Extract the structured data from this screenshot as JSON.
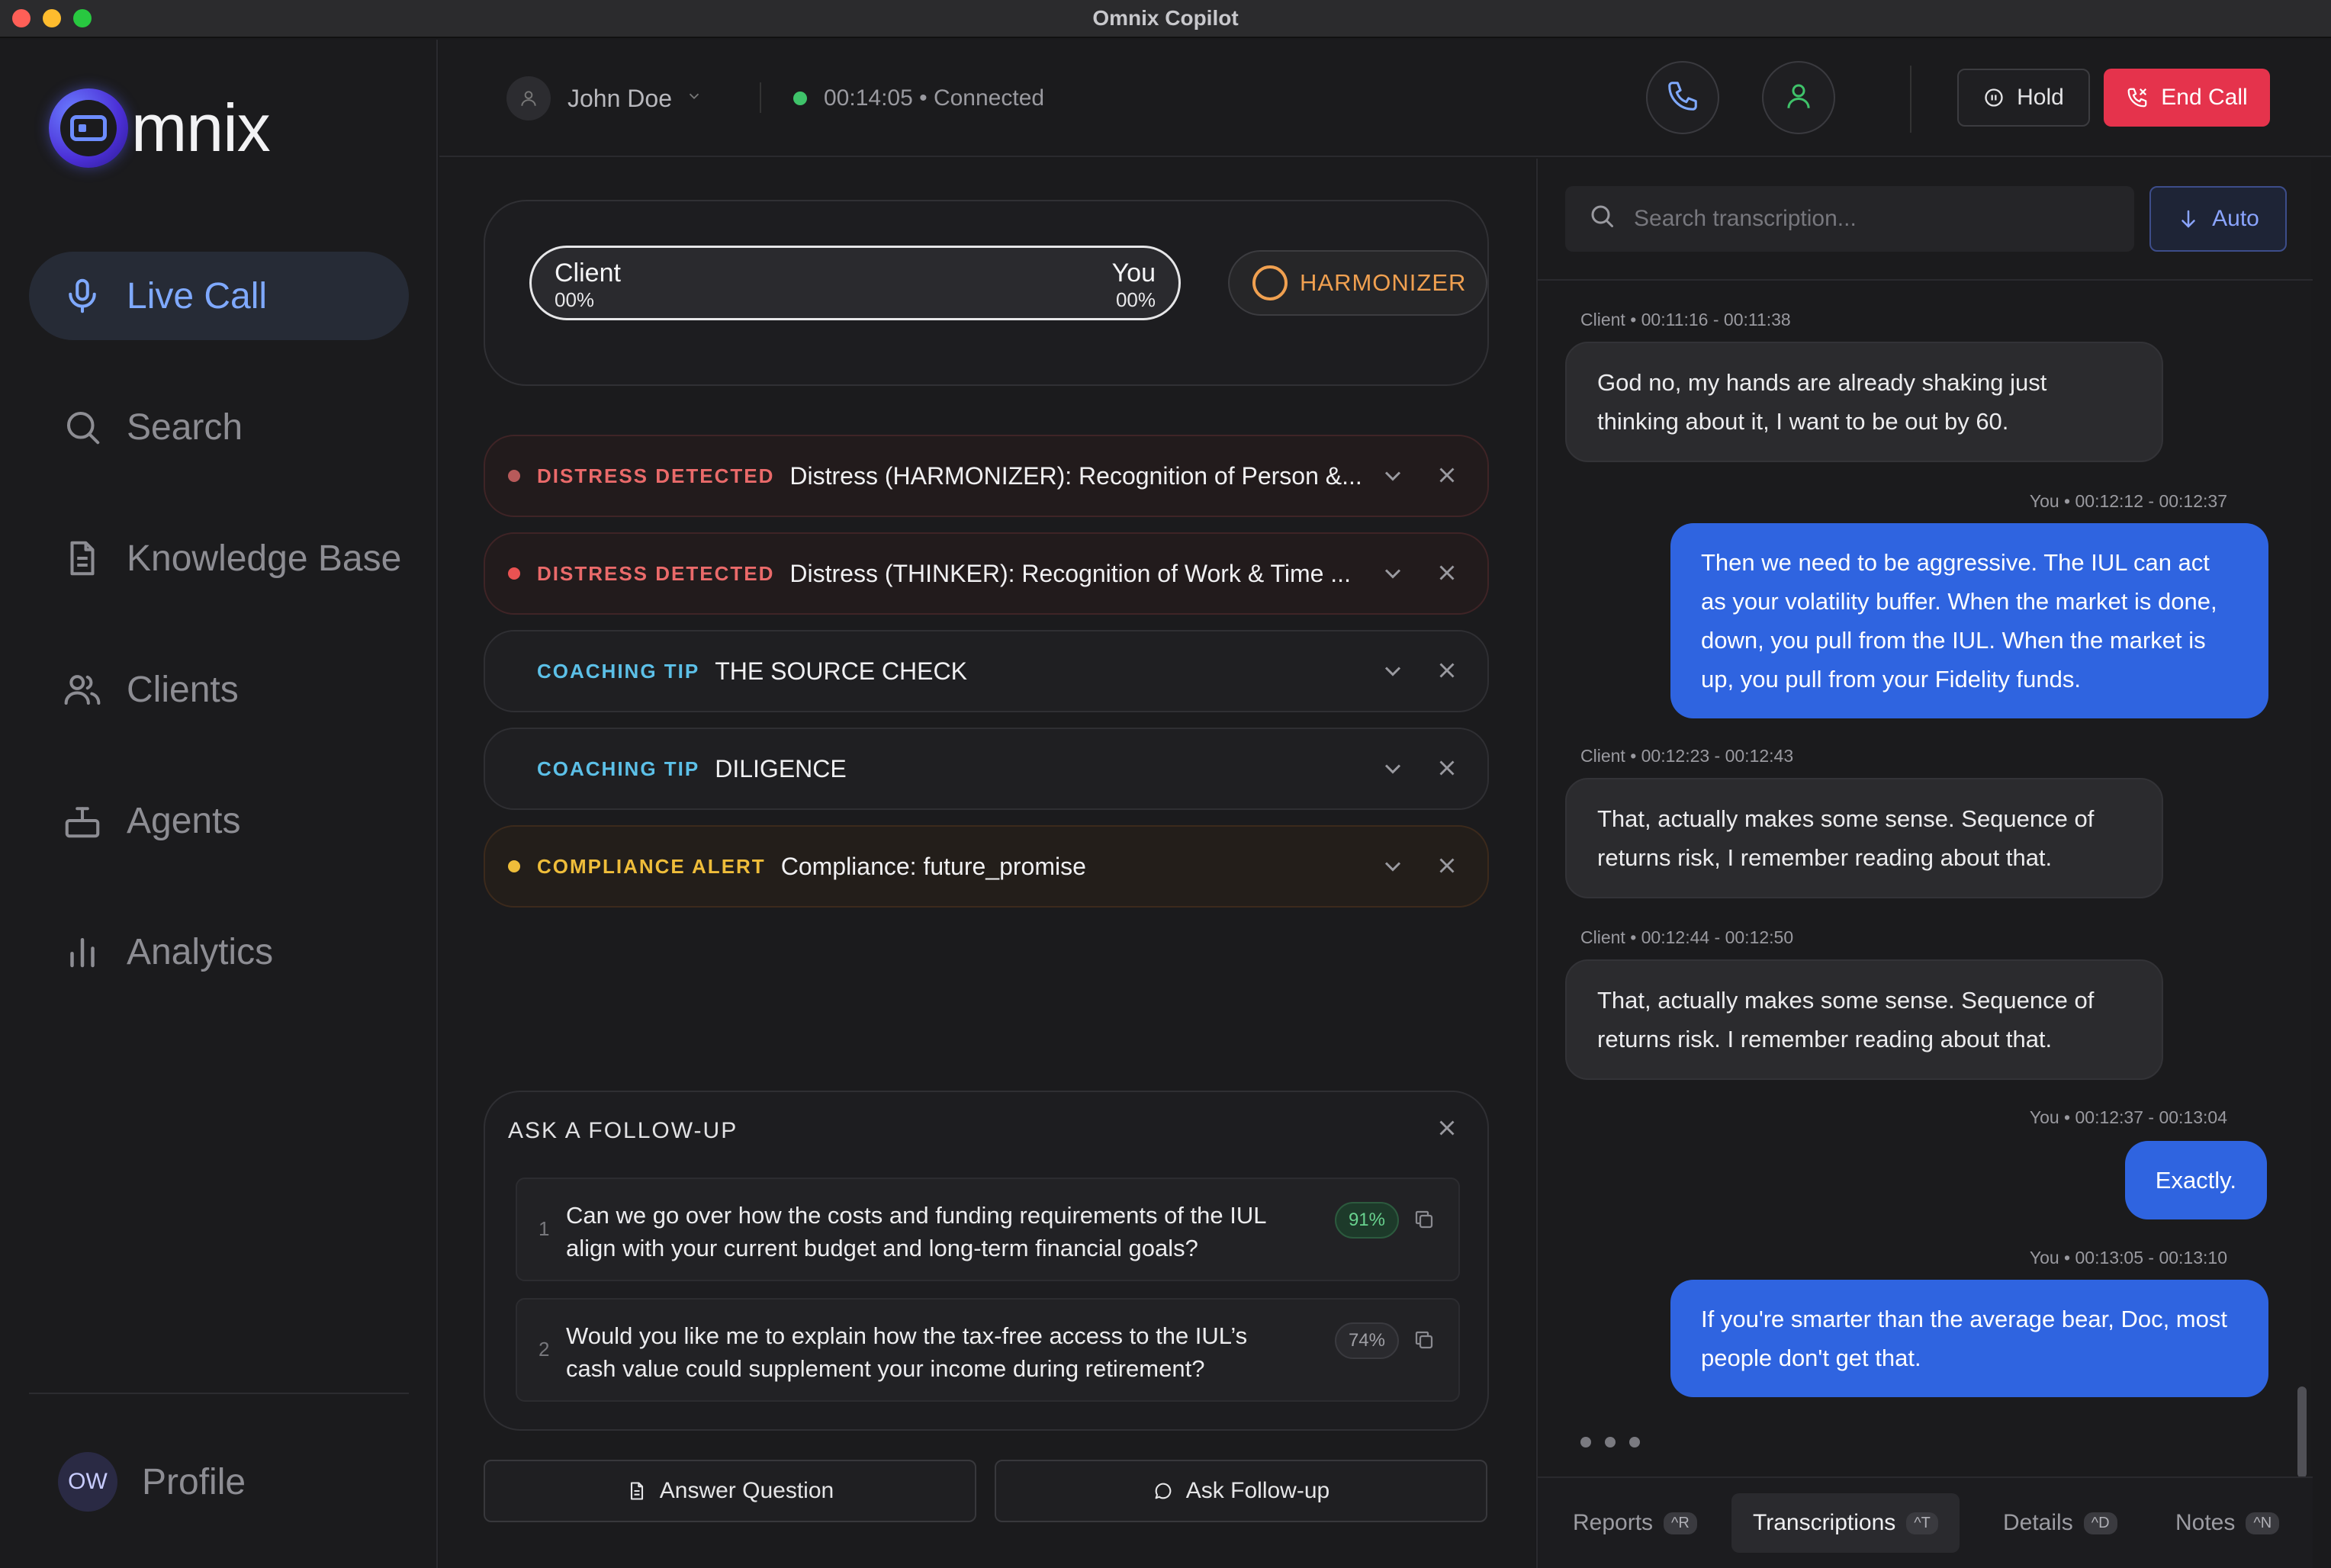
{
  "window": {
    "title": "Omnix Copilot"
  },
  "brand": {
    "logo_text": "mnix"
  },
  "sidebar": {
    "items": [
      {
        "label": "Live Call",
        "icon": "microphone-icon",
        "active": true
      },
      {
        "label": "Search",
        "icon": "search-icon"
      },
      {
        "label": "Knowledge Base",
        "icon": "document-icon"
      },
      {
        "label": "Clients",
        "icon": "users-icon"
      },
      {
        "label": "Agents",
        "icon": "agent-icon"
      },
      {
        "label": "Analytics",
        "icon": "bar-chart-icon"
      }
    ],
    "profile": {
      "initials": "OW",
      "label": "Profile"
    }
  },
  "topbar": {
    "caller_name": "John Doe",
    "call_status": "00:14:05 • Connected",
    "hold_label": "Hold",
    "end_call_label": "End Call"
  },
  "speaker": {
    "client_label": "Client",
    "client_pct": "00%",
    "you_label": "You",
    "you_pct": "00%",
    "persona": "HARMONIZER"
  },
  "alerts": [
    {
      "tag": "DISTRESS DETECTED",
      "text": "Distress (HARMONIZER): Recognition of Person &...",
      "kind": "distress",
      "color": "#b85a5a"
    },
    {
      "tag": "DISTRESS DETECTED",
      "text": "Distress (THINKER): Recognition of Work & Time ...",
      "kind": "distress",
      "color": "#ea5252"
    },
    {
      "tag": "COACHING TIP",
      "text": "THE SOURCE CHECK",
      "kind": "coaching"
    },
    {
      "tag": "COACHING TIP",
      "text": "DILIGENCE",
      "kind": "coaching"
    },
    {
      "tag": "COMPLIANCE ALERT",
      "text": "Compliance: future_promise",
      "kind": "compliance",
      "color": "#efbd3a"
    }
  ],
  "followup": {
    "title": "ASK A FOLLOW-UP",
    "items": [
      {
        "num": "1",
        "text": "Can we go over how the costs and funding requirements of the IUL align with your current budget and long-term financial goals?",
        "score": "91%"
      },
      {
        "num": "2",
        "text": "Would you like me to explain how the tax-free access to the IUL’s cash value could supplement your income during retirement?",
        "score": "74%"
      }
    ],
    "answer_label": "Answer Question",
    "ask_label": "Ask Follow-up"
  },
  "transcript": {
    "search_placeholder": "Search transcription...",
    "auto_label": "Auto",
    "messages": [
      {
        "speaker": "client",
        "meta": "Client • 00:11:16 - 00:11:38",
        "text": "God no, my hands are already shaking just thinking about it, I want to be out by 60."
      },
      {
        "speaker": "you",
        "meta": "You • 00:12:12 - 00:12:37",
        "text": "Then we need to be aggressive. The IUL can act as your volatility buffer. When the market is done, down, you pull from the IUL. When the market is up, you pull from your Fidelity funds."
      },
      {
        "speaker": "client",
        "meta": "Client • 00:12:23 - 00:12:43",
        "text": "That, actually makes some sense. Sequence of returns risk, I remember reading about that."
      },
      {
        "speaker": "client",
        "meta": "Client • 00:12:44 - 00:12:50",
        "text": "That, actually makes some sense. Sequence of returns risk. I remember reading about that."
      },
      {
        "speaker": "you",
        "meta": "You • 00:12:37 - 00:13:04",
        "text": "Exactly."
      },
      {
        "speaker": "you",
        "meta": "You • 00:13:05 - 00:13:10",
        "text": "If you're smarter than the average bear, Doc, most people don't get that."
      }
    ]
  },
  "tabs": [
    {
      "label": "Reports",
      "shortcut": "^R"
    },
    {
      "label": "Transcriptions",
      "shortcut": "^T",
      "active": true
    },
    {
      "label": "Details",
      "shortcut": "^D"
    },
    {
      "label": "Notes",
      "shortcut": "^N"
    }
  ],
  "colors": {
    "accent": "#2f64e0",
    "danger": "#e5334c",
    "active_nav": "#7fa9ff",
    "persona": "#f0a050"
  }
}
